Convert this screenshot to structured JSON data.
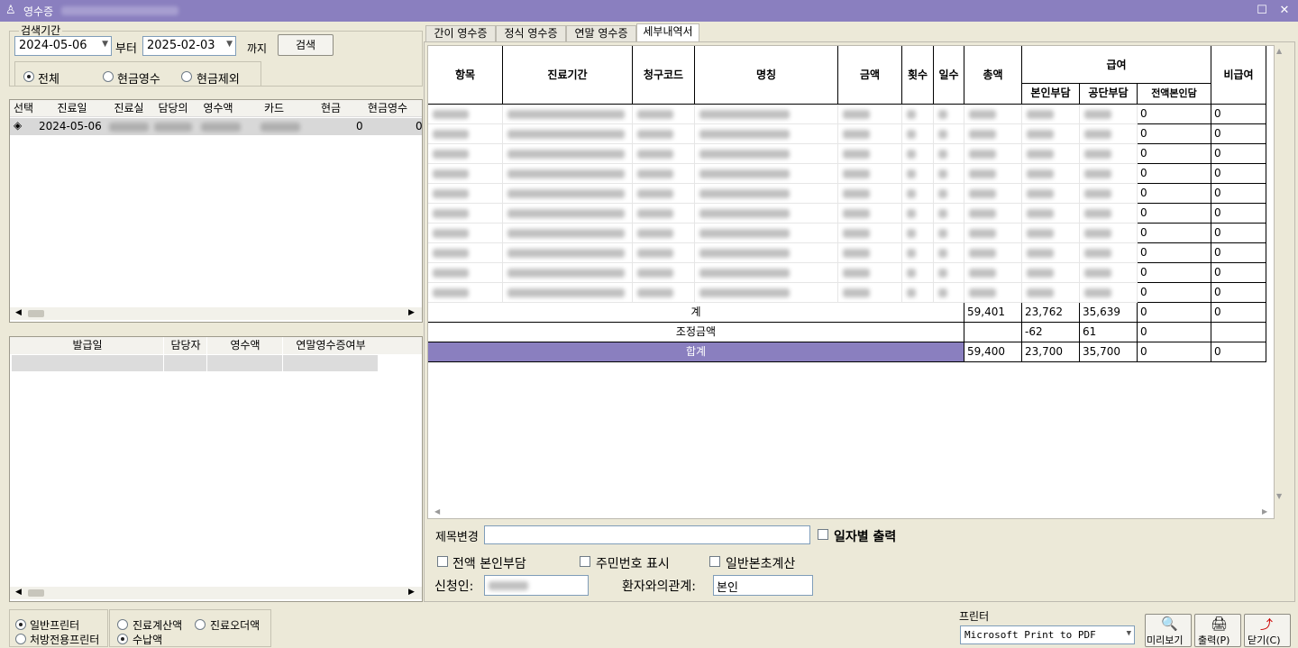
{
  "window": {
    "title": "영수증"
  },
  "search": {
    "group_label": "검색기간",
    "from_date": "2024-05-06",
    "from_label": "부터",
    "to_date": "2025-02-03",
    "to_label": "까지",
    "search_button": "검색",
    "filters": [
      "전체",
      "현금영수",
      "현금제외"
    ],
    "selected_filter": "전체"
  },
  "visit_list": {
    "columns": [
      "선택",
      "진료일",
      "진료실",
      "담당의",
      "영수액",
      "카드",
      "현금",
      "현금영수"
    ],
    "rows": [
      {
        "selected": "◈",
        "date": "2024-05-06",
        "cash": "0",
        "cash_receipt": "0"
      }
    ]
  },
  "issue_list": {
    "columns": [
      "발급일",
      "담당자",
      "영수액",
      "연말영수증여부"
    ]
  },
  "tabs": [
    "간이 영수증",
    "정식 영수증",
    "연말 영수증",
    "세부내역서"
  ],
  "active_tab": "세부내역서",
  "detail": {
    "headers": {
      "item": "항목",
      "period": "진료기간",
      "code": "청구코드",
      "name": "명칭",
      "amount": "금액",
      "count": "횟수",
      "days": "일수",
      "total": "총액",
      "covered": "급여",
      "self_pay": "본인부담",
      "corp_pay": "공단부담",
      "full_self": "전액본인담",
      "non_covered": "비급여"
    },
    "rows": [
      {
        "full_self": "0",
        "non_covered": "0"
      },
      {
        "full_self": "0",
        "non_covered": "0"
      },
      {
        "full_self": "0",
        "non_covered": "0"
      },
      {
        "full_self": "0",
        "non_covered": "0"
      },
      {
        "full_self": "0",
        "non_covered": "0"
      },
      {
        "full_self": "0",
        "non_covered": "0"
      },
      {
        "full_self": "0",
        "non_covered": "0"
      },
      {
        "full_self": "0",
        "non_covered": "0"
      },
      {
        "full_self": "0",
        "non_covered": "0"
      },
      {
        "full_self": "0",
        "non_covered": "0"
      }
    ],
    "subtotal": {
      "label": "계",
      "total": "59,401",
      "self_pay": "23,762",
      "corp_pay": "35,639",
      "full_self": "0",
      "non_covered": "0"
    },
    "adjust": {
      "label": "조정금액",
      "total": "",
      "self_pay": "-62",
      "corp_pay": "61",
      "full_self": "0",
      "non_covered": ""
    },
    "grand_total": {
      "label": "합계",
      "total": "59,400",
      "self_pay": "23,700",
      "corp_pay": "35,700",
      "full_self": "0",
      "non_covered": "0"
    }
  },
  "options": {
    "title_change_label": "제목변경",
    "title_change_value": "",
    "daily_output": "일자별 출력",
    "full_self_pay": "전액 본인부담",
    "show_rrn": "주민번호 표시",
    "general_excess": "일반본초계산",
    "applicant_label": "신청인:",
    "relation_label": "환자와의관계:",
    "relation_value": "본인"
  },
  "printer_mode": {
    "options": [
      "일반프린터",
      "처방전용프린터"
    ],
    "selected": "일반프린터"
  },
  "amount_mode": {
    "options": [
      "진료계산액",
      "진료오더액",
      "수납액"
    ],
    "selected": "수납액"
  },
  "printer": {
    "label": "프린터",
    "value": "Microsoft Print to PDF"
  },
  "buttons": {
    "preview": "미리보기",
    "print": "출력(P)",
    "close": "닫기(C)"
  },
  "colors": {
    "title_bar": "#8a7fbf",
    "grand_total_row": "#8a7fbf"
  }
}
